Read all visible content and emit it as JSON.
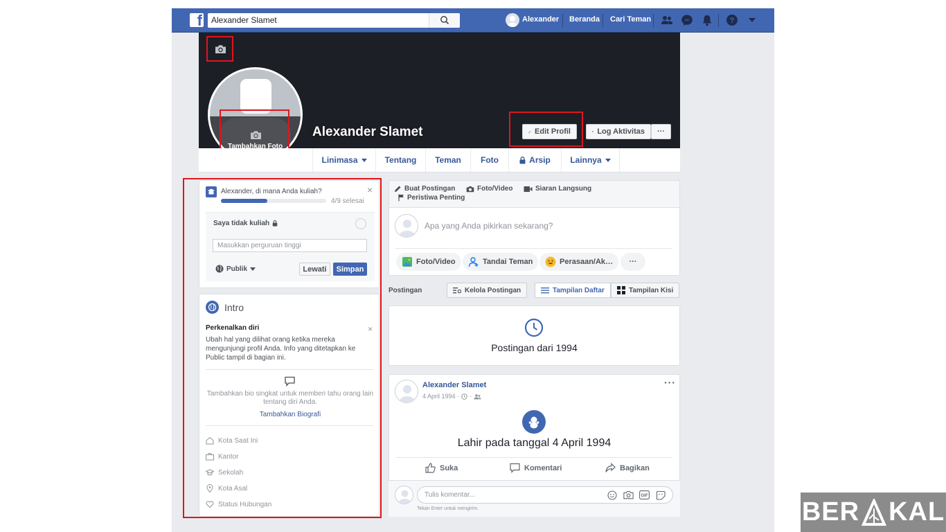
{
  "topbar": {
    "search_value": "Alexander Slamet",
    "user_name": "Alexander",
    "links": [
      "Beranda",
      "Cari Teman"
    ],
    "icons": [
      "friends-icon",
      "messenger-icon",
      "notifications-icon",
      "help-icon",
      "dropdown-arrow-icon"
    ],
    "color": "#4267b2"
  },
  "profile": {
    "name": "Alexander Slamet",
    "add_photo_label": "Tambahkan Foto",
    "edit_profile_label": "Edit Profil",
    "activity_log_label": "Log Aktivitas",
    "more_label": "···"
  },
  "nav_tabs": [
    {
      "label": "Linimasa",
      "dropdown": true
    },
    {
      "label": "Tentang",
      "dropdown": false
    },
    {
      "label": "Teman",
      "dropdown": false
    },
    {
      "label": "Foto",
      "dropdown": false
    },
    {
      "label": "Arsip",
      "dropdown": false,
      "locked": true
    },
    {
      "label": "Lainnya",
      "dropdown": true
    }
  ],
  "education_prompt": {
    "question": "Alexander, di mana Anda kuliah?",
    "progress_text": "4/9 selesai",
    "progress_fraction": 0.444,
    "checkbox_label": "Saya tidak kuliah",
    "input_placeholder": "Masukkan perguruan tinggi",
    "privacy_label": "Publik",
    "skip_label": "Lewati",
    "save_label": "Simpan"
  },
  "intro": {
    "title": "Intro",
    "heading": "Perkenalkan diri",
    "description": "Ubah hal yang dilihat orang ketika mereka mengunjungi profil Anda. Info yang ditetapkan ke Public tampil di bagian ini.",
    "bio_hint": "Tambahkan bio singkat untuk memberi tahu orang lain tentang diri Anda.",
    "bio_link": "Tambahkan Biografi",
    "items": [
      "Kota Saat Ini",
      "Kantor",
      "Sekolah",
      "Kota Asal",
      "Status Hubungan"
    ]
  },
  "composer": {
    "tabs": [
      "Buat Postingan",
      "Foto/Video",
      "Siaran Langsung",
      "Peristiwa Penting"
    ],
    "placeholder": "Apa yang Anda pikirkan sekarang?",
    "actions": [
      "Foto/Video",
      "Tandai Teman",
      "Perasaan/Ak…"
    ],
    "more": "···"
  },
  "posts_bar": {
    "label": "Postingan",
    "manage": "Kelola Postingan",
    "list_view": "Tampilan Daftar",
    "grid_view": "Tampilan Kisi"
  },
  "year_card": {
    "text": "Postingan dari 1994"
  },
  "post": {
    "author": "Alexander Slamet",
    "date": "4 April 1994 · ",
    "event": "Lahir pada tanggal 4 April 1994",
    "like": "Suka",
    "comment": "Komentari",
    "share": "Bagikan",
    "comment_placeholder": "Tulis komentar...",
    "enter_hint": "Tekan Enter untuk mengirim.",
    "menu": "···"
  },
  "watermark": {
    "text_left": "BER",
    "text_right": "KAL"
  }
}
